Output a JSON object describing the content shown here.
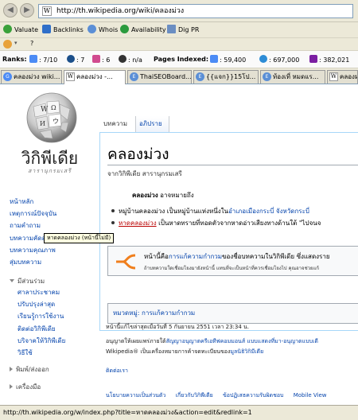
{
  "browser": {
    "url": "http://th.wikipedia.org/wiki/คลองม่วง",
    "status_url": "http://th.wikipedia.org/w/index.php?title=หาดคลองม่วง&action=edit&redlink=1"
  },
  "seo_toolbar": {
    "items": [
      "Valuate",
      "Backlinks",
      "Whois",
      "Availability",
      "Dig PR"
    ],
    "second_row": "?"
  },
  "ranks": {
    "label": "Ranks:",
    "google": ": 7/10",
    "alexa": ": 7",
    "compete": ": 6",
    "quantcast": ": n/a",
    "pages_label": "Pages Indexed:",
    "google_pages": ": 59,400",
    "bing_pages": ": 697,000",
    "yahoo_pages": ": 382,021"
  },
  "tabs": [
    {
      "label": "คลองม่วง wiki...",
      "fav": "G"
    },
    {
      "label": "คลองม่วง -...",
      "fav": "W"
    },
    {
      "label": "ThaiSEOBoard...",
      "fav": "E"
    },
    {
      "label": "{{แจก}}15โป...",
      "fav": "E"
    },
    {
      "label": "ท้องเที่ หมดแร...",
      "fav": "E"
    },
    {
      "label": "คลองม่",
      "fav": "W"
    }
  ],
  "wiki": {
    "name": "วิกิพีเดีย",
    "tagline": "สารานุกรมเสรี",
    "nav": [
      "หน้าหลัก",
      "เหตุการณ์ปัจจุบัน",
      "ถามคำถาม",
      "บทความคัดสรร",
      "บทความคุณภาพ",
      "สุ่มบทความ"
    ],
    "participate_heading": "มีส่วนร่วม",
    "participate": [
      "ศาลาประชาคม",
      "ปรับปรุงล่าสุด",
      "เรียนรู้การใช้งาน",
      "ติดต่อวิกิพีเดีย",
      "บริจาคให้วิกิพีเดีย",
      "วิธีใช้"
    ],
    "print_heading": "พิมพ์/ส่งออก",
    "tools_heading": "เครื่องมือ",
    "content_tabs": [
      "บทความ",
      "อภิปราย"
    ]
  },
  "article": {
    "title": "คลองม่วง",
    "sitesub": "จากวิกิพีเดีย สารานุกรมเสรี",
    "disambig_bold": "คลองม่วง",
    "disambig_rest": " อาจหมายถึง",
    "bullet1_text": "หมู่บ้านคลองม่วง เป็นหมู่บ้านแห่งหนึ่งใน",
    "bullet1_link": "อำเภอเมืองกระบี่ จังหวัดกระบี่",
    "bullet2_link": "หาดคลองม่วง",
    "bullet2_text": " เป็นหาดทรายที่ทอดตัวจากหาดอ่าวเสียงทางด้านใต้ \"ไปจนจ",
    "tooltip": "หาดคลองม่วง (หน้านี้ไม่มี)",
    "mbox_pre": "หน้านี้คือ",
    "mbox_link": "การแก้ความกำกวม",
    "mbox_post": "ของชื่อบทความในวิกิพีเดีย ซึ่งแสดงราย",
    "mbox_small": "ถ้าบทความใดเชื่อมโยงมายังหน้านี้ แทนที่จะเป็นหน้าที่ควรเชื่อมโยงไป คุณอาจช่วยแก้",
    "category_label": "หมวดหมู่",
    "category_link": ": การแก้ความกำกวม"
  },
  "footer": {
    "modified": "หน้านี้แก้ไขล่าสุดเมื่อวันที่ 5 กันยายน 2551 เวลา 23:34 น.",
    "license1_pre": "อนุญาตให้เผยแพร่ภายใต้",
    "license1_link": "สัญญาอนุญาตครีเอทีฟคอมมอนส์ แบบแสดงที่มา-อนุญาตแบบเดี",
    "license2": "Wikipedia® เป็นเครื่องหมายการค้าจดทะเบียนของ",
    "license2_link": "มูลนิธิวิกิมีเดีย",
    "contact": "ติดต่อเรา",
    "links": [
      "นโยบายความเป็นส่วนตัว",
      "เกี่ยวกับวิกิพีเดีย",
      "ข้อปฏิเสธความรับผิดชอบ",
      "Mobile View"
    ]
  }
}
